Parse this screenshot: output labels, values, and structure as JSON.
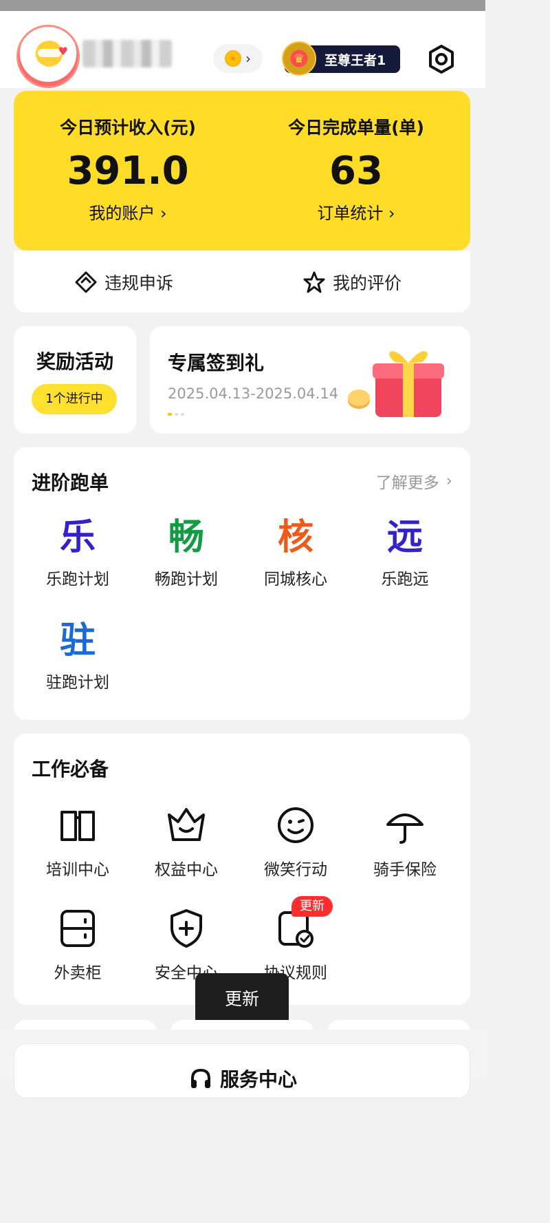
{
  "header": {
    "rank_label": "至尊王者1",
    "icons": {
      "avatar": "rider-avatar",
      "coin": "coin-icon",
      "settings": "settings-icon"
    }
  },
  "income": {
    "left_label": "今日预计收入(元)",
    "left_value": "391.0",
    "left_link": "我的账户",
    "right_label": "今日完成单量(单)",
    "right_value": "63",
    "right_link": "订单统计"
  },
  "actions": {
    "appeal": "违规申诉",
    "rating": "我的评价"
  },
  "reward": {
    "title": "奖励活动",
    "badge": "1个进行中"
  },
  "signin": {
    "title": "专属签到礼",
    "date_range": "2025.04.13-2025.04.14"
  },
  "advance": {
    "title": "进阶跑单",
    "more": "了解更多",
    "items": [
      {
        "glyph": "乐",
        "label": "乐跑计划",
        "color": "#3322cc"
      },
      {
        "glyph": "畅",
        "label": "畅跑计划",
        "color": "#129a44"
      },
      {
        "glyph": "核",
        "label": "同城核心",
        "color": "#ee5a1a"
      },
      {
        "glyph": "远",
        "label": "乐跑远",
        "color": "#3322cc"
      },
      {
        "glyph": "驻",
        "label": "驻跑计划",
        "color": "#1a6ad6"
      }
    ]
  },
  "work": {
    "title": "工作必备",
    "items": [
      {
        "label": "培训中心",
        "icon": "book-icon"
      },
      {
        "label": "权益中心",
        "icon": "crown-icon"
      },
      {
        "label": "微笑行动",
        "icon": "smile-icon"
      },
      {
        "label": "骑手保险",
        "icon": "umbrella-icon"
      },
      {
        "label": "外卖柜",
        "icon": "locker-icon"
      },
      {
        "label": "安全中心",
        "icon": "shield-icon"
      },
      {
        "label": "协议规则",
        "icon": "agreement-icon"
      }
    ],
    "new_badge": "更新"
  },
  "tooltip": {
    "text": "更新"
  },
  "service": {
    "title": "服务中心"
  }
}
